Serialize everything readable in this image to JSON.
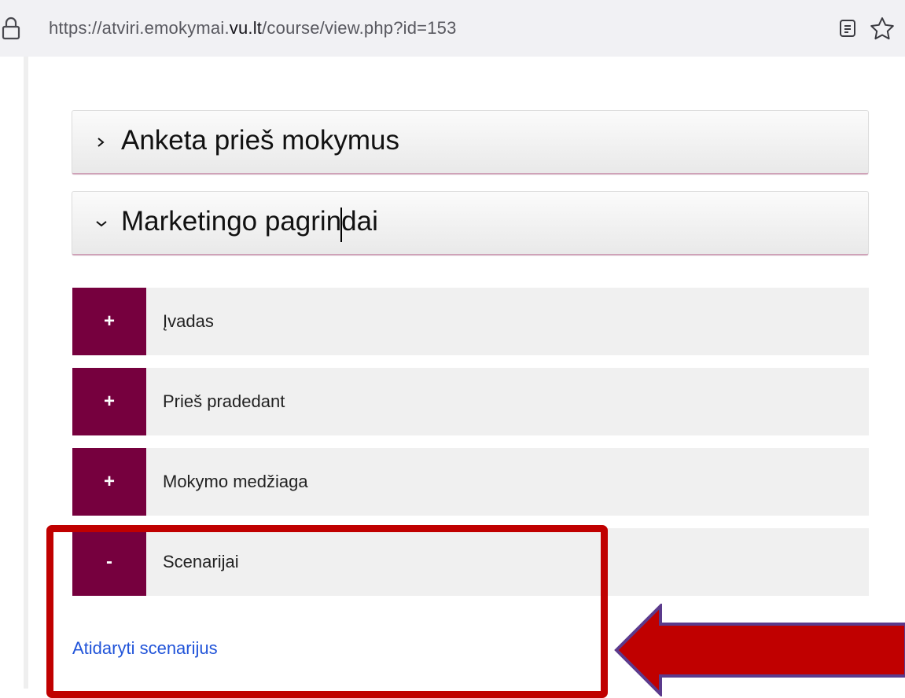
{
  "browser": {
    "url_prefix": "https://atviri.emokymai.",
    "url_domain": "vu.lt",
    "url_path": "/course/view.php?id=153",
    "icons": [
      "lock-icon",
      "reader-view-icon",
      "bookmark-star-icon"
    ]
  },
  "sections": [
    {
      "title": "Anketa prieš mokymus",
      "state": "collapsed",
      "icon": "chevron-right-icon"
    },
    {
      "title": "Marketingo pagrindai",
      "state": "expanded",
      "icon": "chevron-down-icon"
    }
  ],
  "topics": [
    {
      "toggle": "+",
      "label": "Įvadas"
    },
    {
      "toggle": "+",
      "label": "Prieš pradedant"
    },
    {
      "toggle": "+",
      "label": "Mokymo medžiaga"
    },
    {
      "toggle": "-",
      "label": "Scenarijai"
    }
  ],
  "link": {
    "label": "Atidaryti scenarijus"
  },
  "colors": {
    "accent": "#76003e",
    "link": "#2154d9",
    "annotation": "#c00000",
    "annotation_outline": "#5b3a8c",
    "topic_background": "#f0f0f0"
  }
}
